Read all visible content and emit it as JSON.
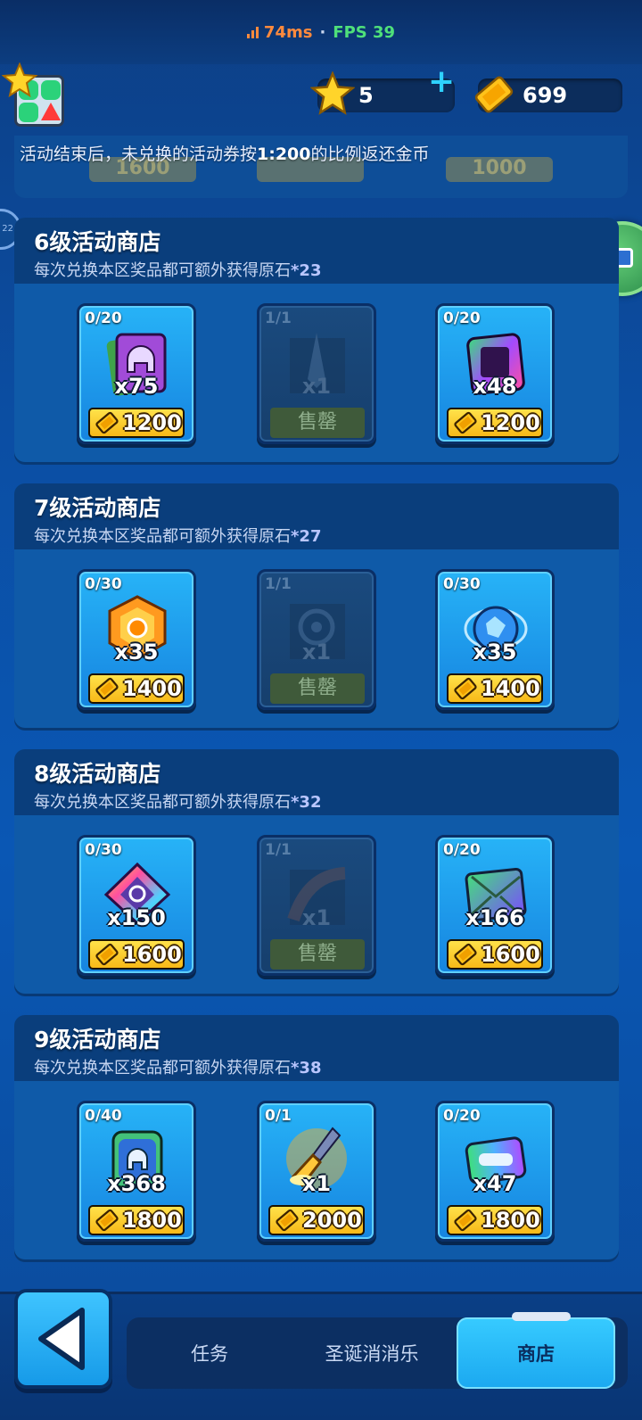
{
  "network": {
    "latency": "74ms",
    "separator": "·",
    "fps": "FPS 39"
  },
  "header": {
    "stars": "5",
    "tickets": "699",
    "add_icon": "plus-icon"
  },
  "notice": {
    "prefix": "活动结束后，未兑换的活动券按",
    "ratio": "1:200",
    "suffix": "的比例返还金币"
  },
  "partial_prices": [
    "1600",
    "",
    "1000"
  ],
  "side_badge": "22",
  "shops": [
    {
      "title": "6级活动商店",
      "subtitle": "每次兑换本区奖品都可额外获得原石",
      "bonus": "*23",
      "items": [
        {
          "limit": "0/20",
          "qty": "x75",
          "price": "1200",
          "icon": "purple-helmet-cards",
          "sold_out": false
        },
        {
          "limit": "1/1",
          "qty": "x1",
          "sold_label": "售罄",
          "icon": "spear-skin",
          "sold_out": true
        },
        {
          "limit": "0/20",
          "qty": "x48",
          "price": "1200",
          "icon": "rainbow-card",
          "sold_out": false
        }
      ]
    },
    {
      "title": "7级活动商店",
      "subtitle": "每次兑换本区奖品都可额外获得原石",
      "bonus": "*27",
      "items": [
        {
          "limit": "0/30",
          "qty": "x35",
          "price": "1400",
          "icon": "orange-hex-badge",
          "sold_out": false
        },
        {
          "limit": "1/1",
          "qty": "x1",
          "sold_label": "售罄",
          "icon": "target-avatar",
          "sold_out": true
        },
        {
          "limit": "0/30",
          "qty": "x35",
          "price": "1400",
          "icon": "blue-crystal-orb",
          "sold_out": false
        }
      ]
    },
    {
      "title": "8级活动商店",
      "subtitle": "每次兑换本区奖品都可额外获得原石",
      "bonus": "*32",
      "items": [
        {
          "limit": "0/30",
          "qty": "x150",
          "price": "1600",
          "icon": "rainbow-diamond-badge",
          "sold_out": false
        },
        {
          "limit": "1/1",
          "qty": "x1",
          "sold_label": "售罄",
          "icon": "net-skin",
          "sold_out": true
        },
        {
          "limit": "0/20",
          "qty": "x166",
          "price": "1600",
          "icon": "green-envelope",
          "sold_out": false
        }
      ]
    },
    {
      "title": "9级活动商店",
      "subtitle": "每次兑换本区奖品都可额外获得原石",
      "bonus": "*38",
      "items": [
        {
          "limit": "0/40",
          "qty": "x368",
          "price": "1800",
          "icon": "helmet-chip",
          "sold_out": false
        },
        {
          "limit": "0/1",
          "qty": "x1",
          "price": "2000",
          "icon": "golden-spear",
          "sold_out": false
        },
        {
          "limit": "0/20",
          "qty": "x47",
          "price": "1800",
          "icon": "rainbow-ticket",
          "sold_out": false
        }
      ]
    }
  ],
  "nav": {
    "back_icon": "back-arrow-icon",
    "tabs": [
      {
        "label": "任务"
      },
      {
        "label": "圣诞消消乐"
      },
      {
        "label": "商店",
        "active": true
      }
    ]
  },
  "colors": {
    "accent": "#1ba8f0",
    "price_gold": "#f7b918",
    "bg": "#0b4ea3"
  }
}
